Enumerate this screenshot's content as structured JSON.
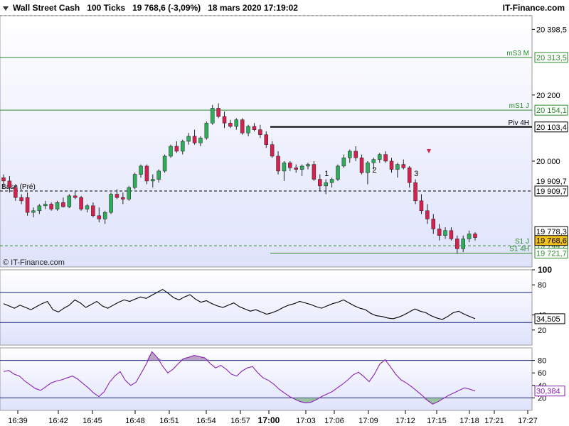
{
  "header": {
    "instrument": "Wall Street Cash",
    "timeframe": "100 Ticks",
    "price_change": "19 768,6 (-3,09%)",
    "datetime": "18 mars 2020 17:19:02",
    "brand": "IT-Finance.com"
  },
  "watermark": "© IT-Finance.com",
  "colors": {
    "up": "#2eae5a",
    "down": "#d6204e",
    "pivot": "#000000",
    "support": "#2c8a2c",
    "rsi": "#000000",
    "stoch": "#8a22b8",
    "osc_fill": "#a07aa8"
  },
  "chart_data": [
    {
      "type": "candlestick",
      "ylim": [
        19680,
        20440
      ],
      "grid": false,
      "y_ticks": [
        "20 398,5",
        "20 200",
        "20 000",
        "19 909,7"
      ],
      "x_ticks": [
        "16:39",
        "16:42",
        "16:45",
        "16:48",
        "16:51",
        "16:54",
        "16:57",
        "17:00",
        "17:03",
        "17:06",
        "17:09",
        "17:12",
        "17:15",
        "17:18",
        "17:21",
        "17:27"
      ],
      "levels": [
        {
          "name": "mS3 M",
          "value": 20313.5,
          "label": "20 313,5",
          "style": "solid",
          "color": "#2c8a2c"
        },
        {
          "name": "mS1 J",
          "value": 20154.1,
          "label": "20 154,1",
          "style": "solid",
          "color": "#2c8a2c"
        },
        {
          "name": "Piv 4H",
          "value": 20103.4,
          "label": "20 103,4",
          "style": "solid",
          "color": "#000000"
        },
        {
          "name": "Base (Pré)",
          "value": 19909.7,
          "label": "19 909,7",
          "style": "dashed",
          "color": "#000000"
        },
        {
          "name": "S1 J",
          "value": 19744.2,
          "label": "19 744,2",
          "style": "dashed",
          "color": "#2c8a2c"
        },
        {
          "name": "S1 4H",
          "value": 19721.7,
          "label": "19 721,7",
          "style": "solid",
          "color": "#2c8a2c"
        }
      ],
      "marker_labels": [
        {
          "name": "last-high",
          "value": 19778.3,
          "label": "19 778,3"
        },
        {
          "name": "last-price",
          "value": 19768.6,
          "label": "19 768,6"
        }
      ],
      "count_labels": [
        "1",
        "2",
        "3"
      ],
      "candles": [
        [
          19950,
          19960,
          19920,
          19940
        ],
        [
          19940,
          19955,
          19905,
          19920
        ],
        [
          19920,
          19930,
          19880,
          19890
        ],
        [
          19890,
          19900,
          19870,
          19880
        ],
        [
          19890,
          19905,
          19835,
          19845
        ],
        [
          19845,
          19860,
          19830,
          19850
        ],
        [
          19850,
          19870,
          19840,
          19865
        ],
        [
          19865,
          19880,
          19855,
          19870
        ],
        [
          19870,
          19875,
          19850,
          19855
        ],
        [
          19855,
          19880,
          19850,
          19875
        ],
        [
          19875,
          19890,
          19860,
          19862
        ],
        [
          19862,
          19900,
          19858,
          19895
        ],
        [
          19895,
          19910,
          19885,
          19890
        ],
        [
          19890,
          19895,
          19850,
          19855
        ],
        [
          19855,
          19870,
          19845,
          19865
        ],
        [
          19865,
          19875,
          19830,
          19835
        ],
        [
          19835,
          19860,
          19815,
          19825
        ],
        [
          19825,
          19850,
          19810,
          19845
        ],
        [
          19845,
          19905,
          19840,
          19900
        ],
        [
          19900,
          19915,
          19885,
          19890
        ],
        [
          19890,
          19905,
          19870,
          19885
        ],
        [
          19885,
          19925,
          19880,
          19920
        ],
        [
          19920,
          19965,
          19915,
          19960
        ],
        [
          19960,
          19990,
          19950,
          19985
        ],
        [
          19985,
          19990,
          19930,
          19940
        ],
        [
          19940,
          19960,
          19920,
          19945
        ],
        [
          19945,
          19975,
          19935,
          19970
        ],
        [
          19970,
          20020,
          19965,
          20015
        ],
        [
          20015,
          20050,
          20010,
          20045
        ],
        [
          20045,
          20060,
          20025,
          20030
        ],
        [
          20030,
          20065,
          20020,
          20060
        ],
        [
          20060,
          20085,
          20050,
          20075
        ],
        [
          20075,
          20095,
          20050,
          20055
        ],
        [
          20055,
          20075,
          20045,
          20070
        ],
        [
          20070,
          20120,
          20065,
          20115
        ],
        [
          20115,
          20170,
          20110,
          20160
        ],
        [
          20160,
          20175,
          20130,
          20135
        ],
        [
          20135,
          20150,
          20100,
          20115
        ],
        [
          20115,
          20125,
          20100,
          20105
        ],
        [
          20105,
          20130,
          20095,
          20125
        ],
        [
          20125,
          20130,
          20080,
          20085
        ],
        [
          20085,
          20110,
          20075,
          20105
        ],
        [
          20105,
          20115,
          20090,
          20095
        ],
        [
          20095,
          20110,
          20070,
          20080
        ],
        [
          20080,
          20090,
          20040,
          20050
        ],
        [
          20050,
          20060,
          20010,
          20015
        ],
        [
          20015,
          20030,
          19960,
          19970
        ],
        [
          19970,
          20000,
          19940,
          19995
        ],
        [
          19995,
          20000,
          19970,
          19980
        ],
        [
          19980,
          19990,
          19965,
          19975
        ],
        [
          19975,
          19990,
          19955,
          19985
        ],
        [
          19985,
          19995,
          19975,
          19990
        ],
        [
          19990,
          20000,
          19940,
          19945
        ],
        [
          19945,
          19960,
          19910,
          19925
        ],
        [
          19925,
          19945,
          19900,
          19935
        ],
        [
          19935,
          19950,
          19920,
          19945
        ],
        [
          19945,
          19990,
          19940,
          19985
        ],
        [
          19985,
          20020,
          19980,
          20010
        ],
        [
          20010,
          20035,
          19995,
          20030
        ],
        [
          20030,
          20045,
          20000,
          20010
        ],
        [
          20010,
          20020,
          19960,
          19965
        ],
        [
          19965,
          20000,
          19930,
          19995
        ],
        [
          19995,
          20010,
          19975,
          20005
        ],
        [
          20005,
          20025,
          19995,
          20020
        ],
        [
          20020,
          20030,
          19995,
          20000
        ],
        [
          20000,
          20010,
          19965,
          19975
        ],
        [
          19975,
          19995,
          19950,
          19990
        ],
        [
          19990,
          20005,
          19975,
          19980
        ],
        [
          19980,
          19985,
          19920,
          19935
        ],
        [
          19935,
          19945,
          19870,
          19880
        ],
        [
          19880,
          19900,
          19840,
          19850
        ],
        [
          19850,
          19870,
          19810,
          19825
        ],
        [
          19825,
          19840,
          19780,
          19795
        ],
        [
          19795,
          19810,
          19760,
          19775
        ],
        [
          19775,
          19800,
          19765,
          19790
        ],
        [
          19790,
          19800,
          19760,
          19765
        ],
        [
          19765,
          19775,
          19720,
          19735
        ],
        [
          19735,
          19775,
          19725,
          19765
        ],
        [
          19765,
          19790,
          19755,
          19780
        ],
        [
          19780,
          19785,
          19760,
          19769
        ]
      ]
    },
    {
      "type": "line",
      "series_label": "34,505",
      "y_ticks": [
        "100",
        "80",
        "40",
        "20"
      ],
      "ylim": [
        0,
        100
      ],
      "bands": [
        70,
        30
      ],
      "values": [
        55,
        52,
        49,
        53,
        50,
        47,
        51,
        55,
        58,
        47,
        44,
        49,
        53,
        60,
        56,
        50,
        54,
        58,
        52,
        49,
        53,
        57,
        60,
        58,
        61,
        64,
        62,
        66,
        70,
        74,
        69,
        63,
        60,
        64,
        67,
        61,
        57,
        59,
        55,
        52,
        50,
        53,
        56,
        51,
        48,
        45,
        47,
        44,
        41,
        43,
        46,
        50,
        53,
        55,
        58,
        56,
        54,
        51,
        49,
        52,
        55,
        57,
        60,
        56,
        52,
        49,
        47,
        42,
        39,
        38,
        36,
        35,
        37,
        40,
        44,
        48,
        45,
        43,
        39,
        36,
        34,
        38,
        43,
        45,
        41,
        38,
        35
      ]
    },
    {
      "type": "line",
      "series_label": "30,384",
      "y_ticks": [
        "80",
        "60",
        "40",
        "20"
      ],
      "ylim": [
        0,
        100
      ],
      "bands": [
        80,
        20
      ],
      "values": [
        62,
        64,
        58,
        55,
        47,
        41,
        35,
        32,
        38,
        44,
        47,
        49,
        52,
        55,
        50,
        43,
        36,
        28,
        22,
        30,
        45,
        55,
        62,
        48,
        40,
        45,
        60,
        75,
        94,
        85,
        71,
        60,
        66,
        75,
        83,
        85,
        88,
        86,
        84,
        75,
        68,
        72,
        66,
        58,
        55,
        63,
        68,
        70,
        60,
        52,
        48,
        42,
        34,
        28,
        22,
        18,
        14,
        12,
        13,
        17,
        22,
        26,
        30,
        36,
        42,
        49,
        57,
        61,
        54,
        46,
        58,
        74,
        81,
        70,
        58,
        49,
        44,
        38,
        31,
        24,
        16,
        10,
        14,
        19,
        24,
        28,
        32,
        36,
        34,
        31
      ]
    }
  ]
}
